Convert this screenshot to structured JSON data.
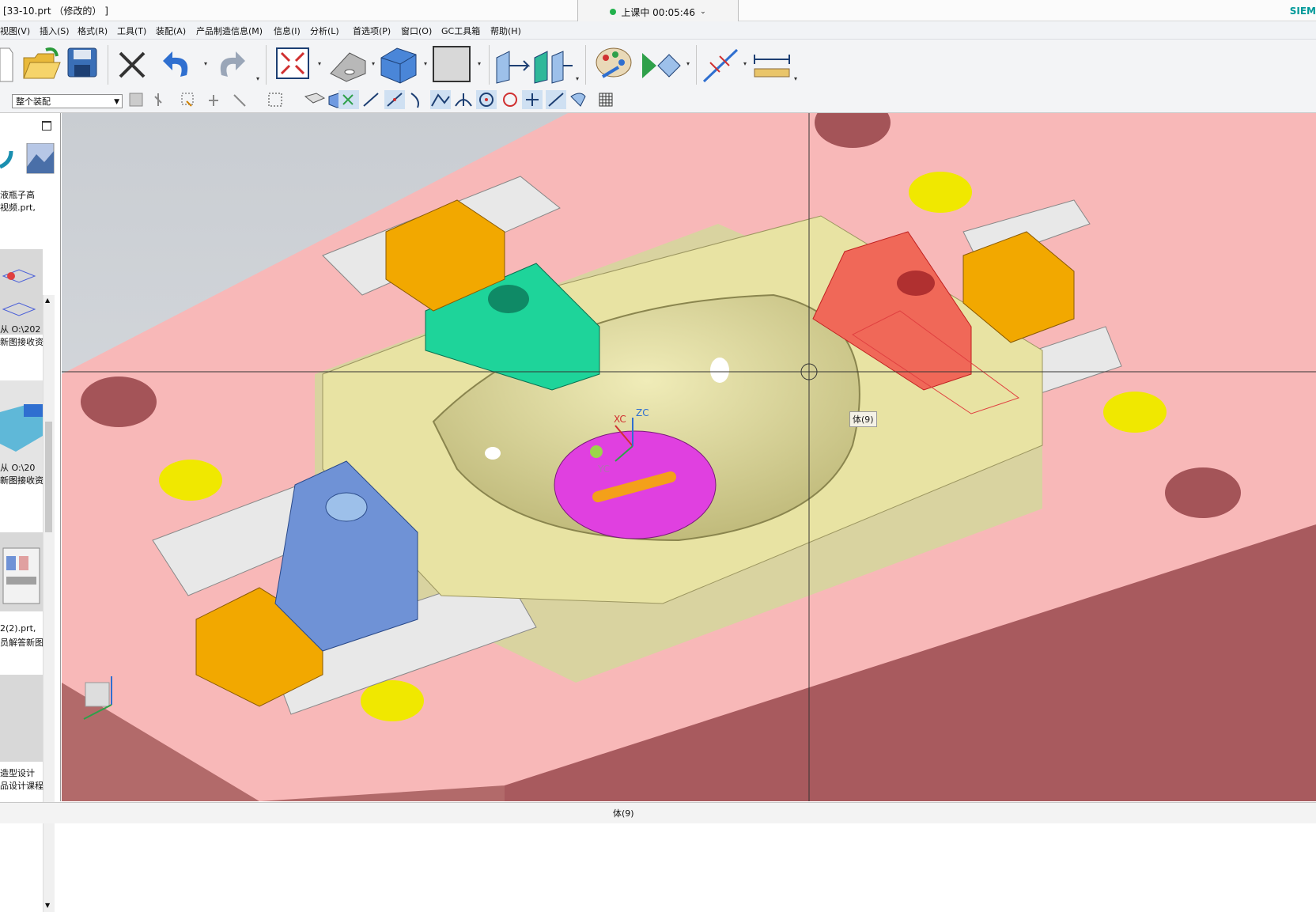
{
  "window": {
    "title": "[33-10.prt （修改的） ]",
    "brand": "SIEM",
    "recording": "上课中 00:05:46"
  },
  "menu": [
    "视图(V)",
    "插入(S)",
    "格式(R)",
    "工具(T)",
    "装配(A)",
    "产品制造信息(M)",
    "信息(I)",
    "分析(L)",
    "首选项(P)",
    "窗口(O)",
    "GC工具箱",
    "帮助(H)"
  ],
  "toolbar": {
    "filter_scope": "整个装配",
    "icons": [
      "new-icon",
      "open-icon",
      "save-icon",
      "delete-icon",
      "undo-icon",
      "redo-icon",
      "fit-icon",
      "wire-icon",
      "shaded-icon",
      "background-icon",
      "orient-icon",
      "view-icon",
      "edit-object-icon",
      "show-hide-icon",
      "wcs-icon",
      "measure-icon"
    ]
  },
  "nav": {
    "items": [
      {
        "line1": "液瓶子高",
        "line2": "视频.prt,"
      },
      {
        "line1": "从 O:\\202",
        "line2": "新图接收资"
      },
      {
        "line1": "从 O:\\20",
        "line2": "新图接收资"
      },
      {
        "line1": "2(2).prt,",
        "line2": "员解答新图"
      },
      {
        "line1": "造型设计",
        "line2": "品设计课程"
      }
    ]
  },
  "viewport": {
    "axis_labels": {
      "xc": "XC",
      "yc": "YC",
      "zc": "ZC"
    },
    "tooltip": "体(9)"
  },
  "status": "体(9)",
  "colors": {
    "plate": "#f8b8b8",
    "core": "#e8e3a3",
    "slider_green": "#1ed49a",
    "slider_blue": "#6f92d6",
    "insert_magenta": "#e040e0",
    "highlight_red": "#f06858"
  }
}
